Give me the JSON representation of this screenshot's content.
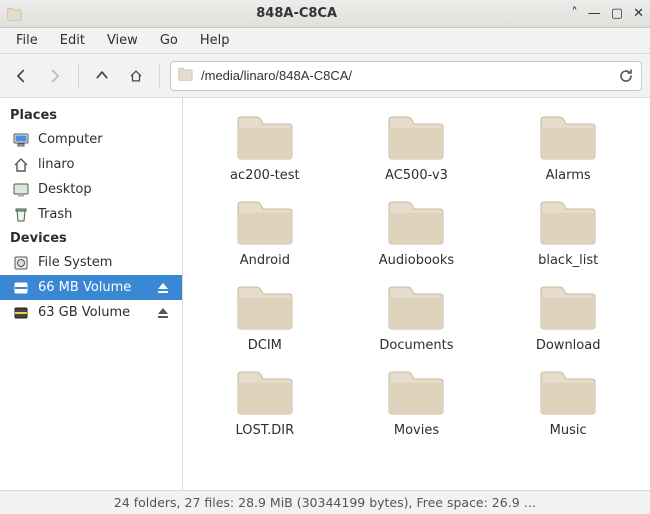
{
  "window": {
    "title": "848A-C8CA"
  },
  "menubar": {
    "items": [
      "File",
      "Edit",
      "View",
      "Go",
      "Help"
    ]
  },
  "toolbar": {
    "path": "/media/linaro/848A-C8CA/"
  },
  "sidebar": {
    "groups": [
      {
        "header": "Places",
        "items": [
          {
            "label": "Computer",
            "icon": "computer"
          },
          {
            "label": "linaro",
            "icon": "home"
          },
          {
            "label": "Desktop",
            "icon": "desktop"
          },
          {
            "label": "Trash",
            "icon": "trash"
          }
        ]
      },
      {
        "header": "Devices",
        "items": [
          {
            "label": "File System",
            "icon": "harddisk"
          },
          {
            "label": "66 MB Volume",
            "icon": "removable",
            "ejectable": true,
            "selected": true
          },
          {
            "label": "63 GB Volume",
            "icon": "removable-dark",
            "ejectable": true
          }
        ]
      }
    ]
  },
  "files": {
    "items": [
      {
        "name": "ac200-test"
      },
      {
        "name": "AC500-v3"
      },
      {
        "name": "Alarms"
      },
      {
        "name": "Android"
      },
      {
        "name": "Audiobooks"
      },
      {
        "name": "black_list"
      },
      {
        "name": "DCIM"
      },
      {
        "name": "Documents"
      },
      {
        "name": "Download"
      },
      {
        "name": "LOST.DIR"
      },
      {
        "name": "Movies"
      },
      {
        "name": "Music"
      }
    ]
  },
  "statusbar": {
    "text": "24 folders, 27 files: 28.9 MiB (30344199 bytes), Free space: 26.9 …"
  }
}
